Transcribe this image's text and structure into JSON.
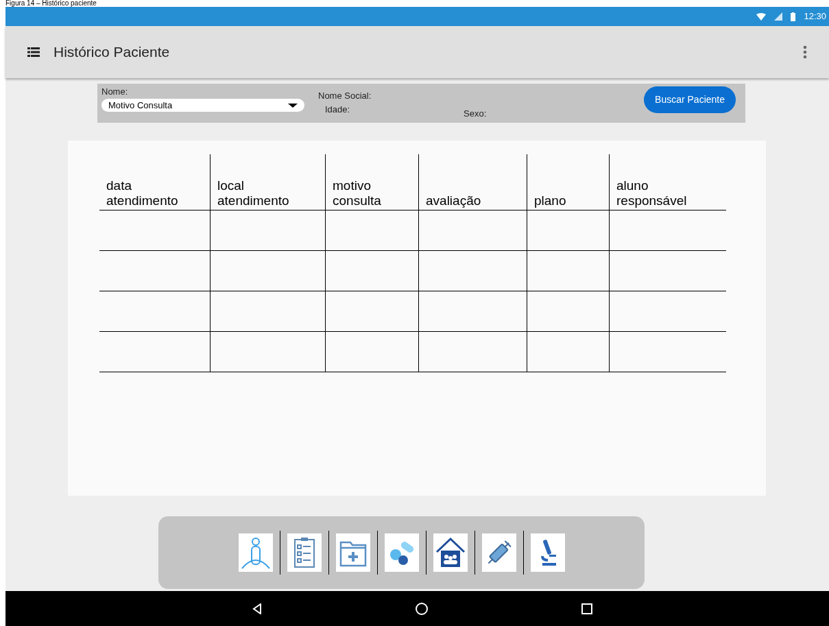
{
  "caption": "Figura 14 – Histórico paciente",
  "status_bar": {
    "time": "12:30"
  },
  "app_bar": {
    "title": "Histórico Paciente"
  },
  "form": {
    "name_label": "Nome:",
    "dropdown_value": "Motivo Consulta",
    "social_name_label": "Nome Social:",
    "age_label": "Idade:",
    "sex_label": "Sexo:",
    "search_button": "Buscar Paciente"
  },
  "table": {
    "columns": [
      "data atendimento",
      "local atendimento",
      "motivo consulta",
      "avaliação",
      "plano",
      "aluno responsável"
    ]
  }
}
